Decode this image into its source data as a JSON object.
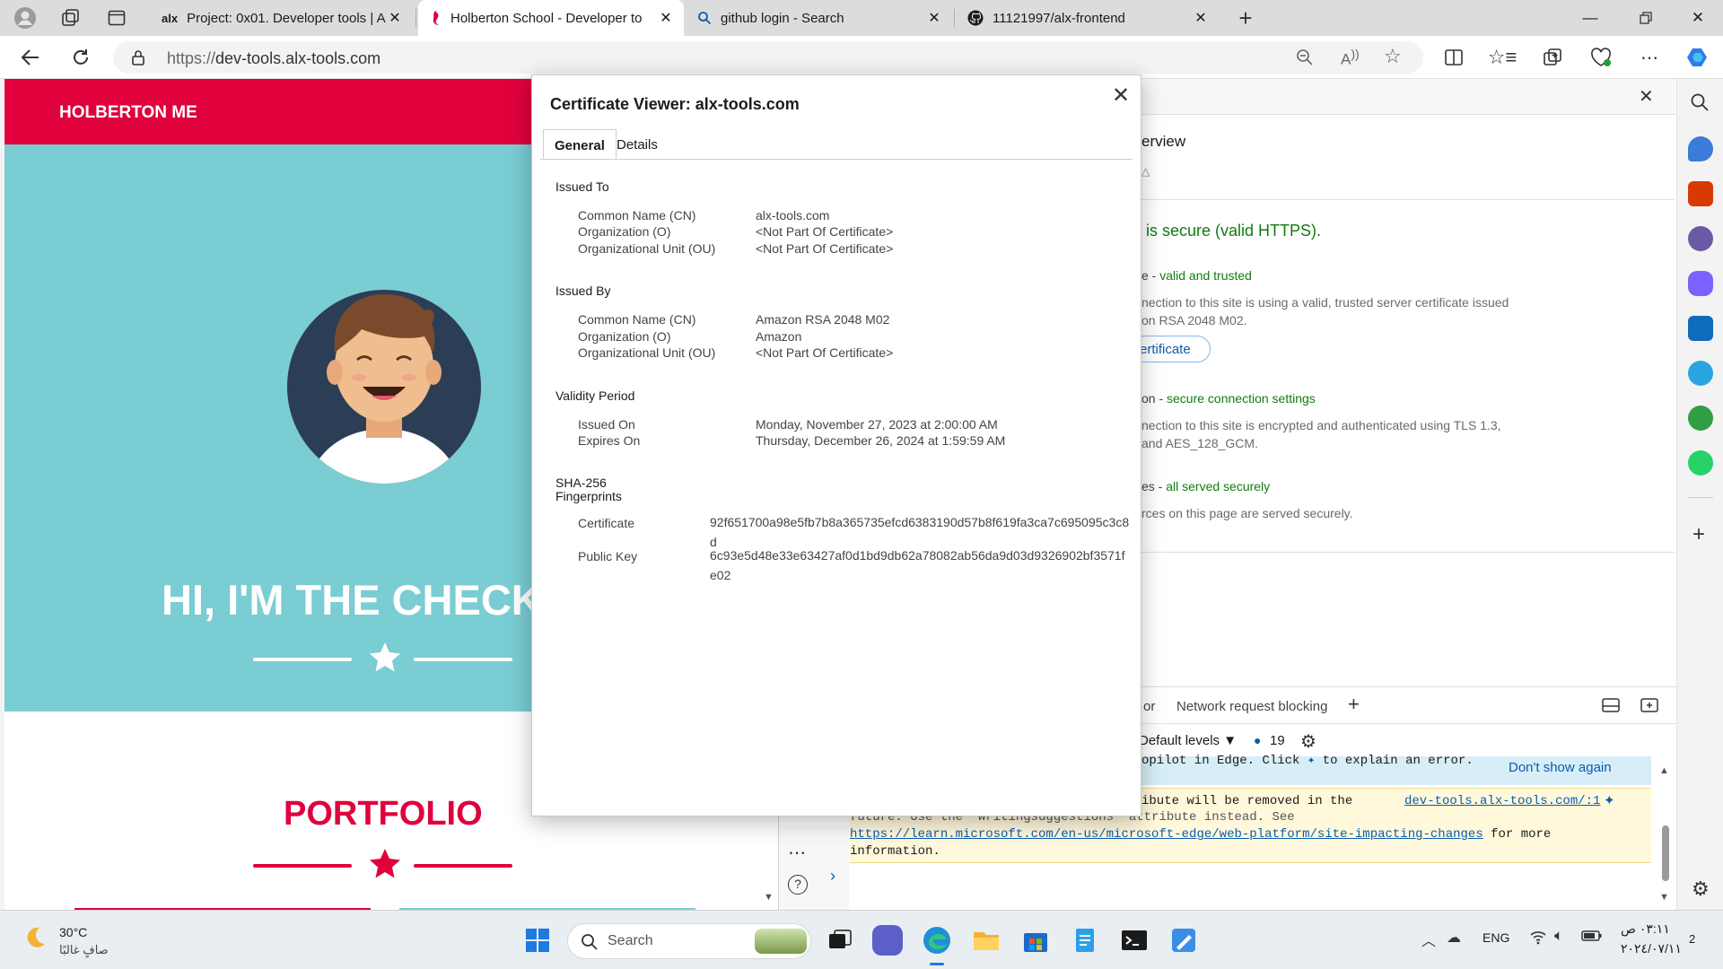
{
  "tabs": [
    {
      "favicon": "alx",
      "title": "Project: 0x01. Developer tools | A",
      "active": false
    },
    {
      "favicon": "holberton-icon",
      "title": "Holberton School - Developer to",
      "active": true
    },
    {
      "favicon": "search-icon",
      "title": "github login - Search",
      "active": false
    },
    {
      "favicon": "github-icon",
      "title": "11121997/alx-frontend",
      "active": false
    }
  ],
  "address_bar": {
    "protocol": "https://",
    "host": "dev-tools.alx-tools.com"
  },
  "site": {
    "brand": "HOLBERTON ME",
    "hero_title": "HI, I'M THE CHECK",
    "portfolio_title": "PORTFOLIO",
    "colors": {
      "header": "#e0003c",
      "hero": "#7acdd3",
      "accent": "#e0003c"
    }
  },
  "devtools": {
    "overview_title": "erview",
    "secure_headline": "is secure (valid HTTPS).",
    "cert_label_prefix": "e - ",
    "cert_status": "valid and trusted",
    "cert_desc_1": "nection to this site is using a valid, trusted server certificate issued",
    "cert_desc_2": "on RSA 2048 M02.",
    "cert_button": "ertificate",
    "conn_label_prefix": "on - ",
    "conn_status": "secure connection settings",
    "conn_desc_1": "nection to this site is encrypted and authenticated using TLS 1.3,",
    "conn_desc_2": "and AES_128_GCM.",
    "res_label_prefix": "es - ",
    "res_status": "all served securely",
    "res_desc": "rces on this page are served securely.",
    "drawer_tab_partial": "or",
    "drawer_tab": "Network request blocking",
    "levels": "Default levels",
    "issue_count": "19",
    "copilot_msg": "opilot in Edge. Click",
    "copilot_msg2": "to explain an error.",
    "dont_show": "Don't show again",
    "warn_line1": "ibute will be removed in the",
    "warn_source": "dev-tools.alx-tools.com/:1",
    "warn_line2": "future. Use the 'writingsuggestions' attribute instead. See",
    "warn_link": "https://learn.microsoft.com/en-us/microsoft-edge/web-platform/site-impacting-changes",
    "warn_line3_suffix": "for more",
    "warn_line4": "information."
  },
  "cert": {
    "title": "Certificate Viewer: alx-tools.com",
    "tabs": [
      "General",
      "Details"
    ],
    "issued_to": {
      "heading": "Issued To",
      "rows": [
        {
          "k": "Common Name (CN)",
          "v": "alx-tools.com"
        },
        {
          "k": "Organization (O)",
          "v": "<Not Part Of Certificate>"
        },
        {
          "k": "Organizational Unit (OU)",
          "v": "<Not Part Of Certificate>"
        }
      ]
    },
    "issued_by": {
      "heading": "Issued By",
      "rows": [
        {
          "k": "Common Name (CN)",
          "v": "Amazon RSA 2048 M02"
        },
        {
          "k": "Organization (O)",
          "v": "Amazon"
        },
        {
          "k": "Organizational Unit (OU)",
          "v": "<Not Part Of Certificate>"
        }
      ]
    },
    "validity": {
      "heading": "Validity Period",
      "rows": [
        {
          "k": "Issued On",
          "v": "Monday, November 27, 2023 at 2:00:00 AM"
        },
        {
          "k": "Expires On",
          "v": "Thursday, December 26, 2024 at 1:59:59 AM"
        }
      ]
    },
    "fingerprints": {
      "heading_1": "SHA-256",
      "heading_2": "Fingerprints",
      "rows": [
        {
          "k": "Certificate",
          "v": "92f651700a98e5fb7b8a365735efcd6383190d57b8f619fa3ca7c695095c3c8d"
        },
        {
          "k": "Public Key",
          "v": "6c93e5d48e33e63427af0d1bd9db62a78082ab56da9d03d9326902bf3571fe02"
        }
      ]
    }
  },
  "taskbar": {
    "weather_temp": "30°C",
    "weather_desc": "صافٍ غالبًا",
    "search_placeholder": "Search",
    "lang": "ENG",
    "time": "٠٣:١١ ص",
    "date": "٢٠٢٤/٠٧/١١",
    "notifications": "2"
  }
}
